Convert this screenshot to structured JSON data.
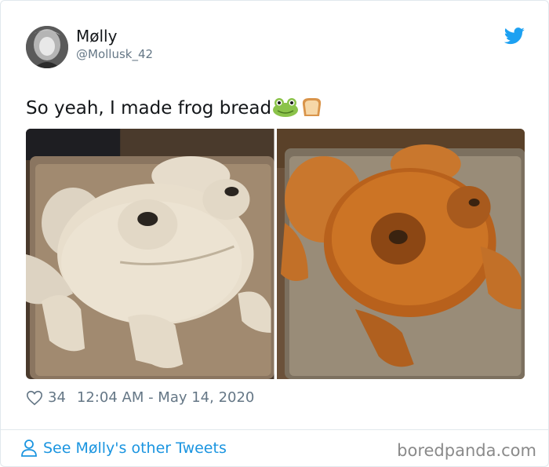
{
  "user": {
    "display_name": "Møll​y",
    "handle": "@Mollusk_42"
  },
  "tweet": {
    "text": "So yeah, I made frog bread",
    "emoji": [
      "frog-face",
      "bread"
    ]
  },
  "media": [
    {
      "description_icon": "photo",
      "subject": "raw-dough-frog"
    },
    {
      "description_icon": "photo",
      "subject": "baked-bread-frog"
    }
  ],
  "meta": {
    "like_count": "34",
    "timestamp": "12:04 AM - May 14, 2020"
  },
  "footer": {
    "see_more_label": "See Møll​y's other Tweets",
    "brand": "boredpanda.com"
  },
  "colors": {
    "twitter_blue": "#1da1f2",
    "link_blue": "#1b95e0",
    "secondary_text": "#657786",
    "border": "#e1e8ed"
  }
}
